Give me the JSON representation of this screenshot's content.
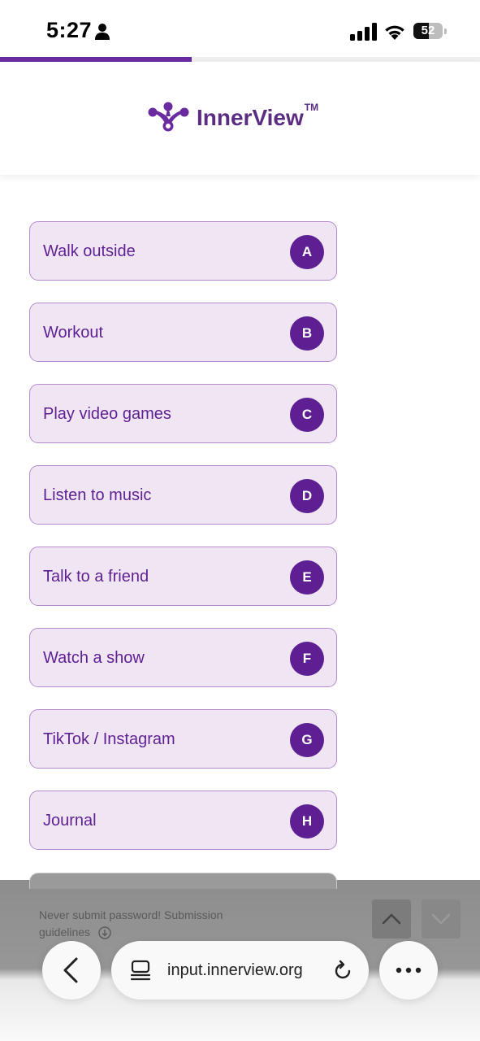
{
  "status_bar": {
    "time": "5:27",
    "battery_level": "52",
    "icons": [
      "person-icon",
      "cellular-signal-icon",
      "wifi-icon",
      "battery-icon"
    ]
  },
  "progress": {
    "fraction": 0.4,
    "color": "#6a2aa0"
  },
  "header": {
    "logo_text": "InnerView",
    "logo_tm": "TM",
    "brand_color": "#5a2d83"
  },
  "options": [
    {
      "label": "Walk outside",
      "key": "A"
    },
    {
      "label": "Workout",
      "key": "B"
    },
    {
      "label": "Play video games",
      "key": "C"
    },
    {
      "label": "Listen to music",
      "key": "D"
    },
    {
      "label": "Talk to a friend",
      "key": "E"
    },
    {
      "label": "Watch a show",
      "key": "F"
    },
    {
      "label": "TikTok / Instagram",
      "key": "G"
    },
    {
      "label": "Journal",
      "key": "H"
    }
  ],
  "footer": {
    "notice": "Never submit password! Submission guidelines",
    "nav_icons": [
      "chevron-up-icon",
      "chevron-down-icon"
    ]
  },
  "browser": {
    "url": "input.innerview.org",
    "icons": [
      "back-icon",
      "site-settings-icon",
      "reload-icon",
      "more-icon"
    ]
  },
  "colors": {
    "option_bg": "#f0e6f3",
    "option_border": "#b48bcf",
    "option_text": "#5e1f93"
  }
}
